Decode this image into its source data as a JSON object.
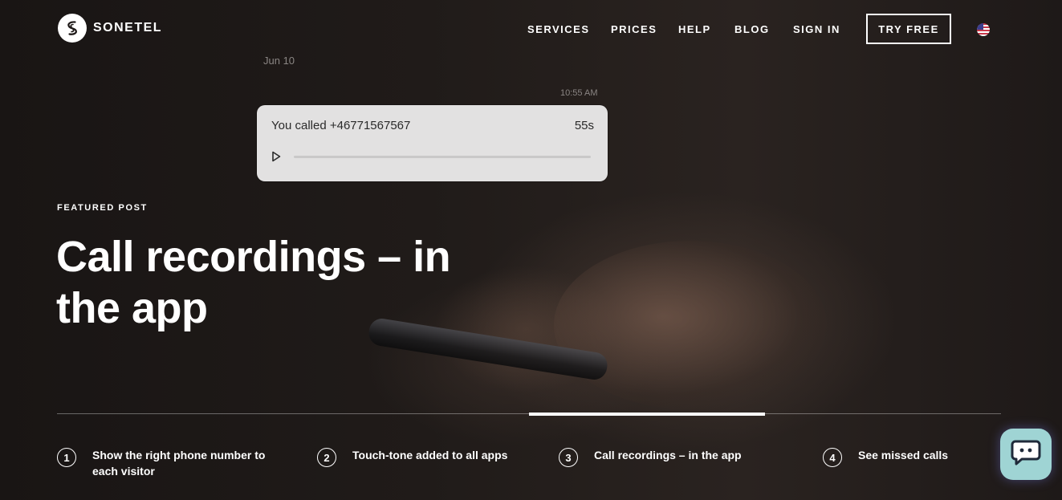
{
  "brand": {
    "name": "SONETEL",
    "logo_icon": "sonetel-logo-icon"
  },
  "nav": {
    "items": [
      "SERVICES",
      "PRICES",
      "HELP",
      "BLOG",
      "SIGN IN"
    ],
    "try_free": "TRY FREE",
    "language_icon": "us-flag-icon"
  },
  "chat_mock": {
    "date": "Jun 10",
    "time": "10:55 AM",
    "call_text": "You called +46771567567",
    "duration": "55s",
    "play_icon": "play-icon"
  },
  "hero": {
    "eyebrow": "FEATURED POST",
    "title_line1": "Call recordings – in",
    "title_line2": "the app"
  },
  "carousel": {
    "active_index": 2,
    "steps": [
      {
        "num": "1",
        "label_line1": "Show the right phone number to",
        "label_line2": "each visitor"
      },
      {
        "num": "2",
        "label_line1": "Touch-tone added to all apps"
      },
      {
        "num": "3",
        "label_line1": "Call recordings – in the app"
      },
      {
        "num": "4",
        "label_line1": "See missed calls"
      }
    ]
  },
  "chat_widget": {
    "icon": "chat-bubble-icon",
    "color": "#9fd4d4"
  }
}
